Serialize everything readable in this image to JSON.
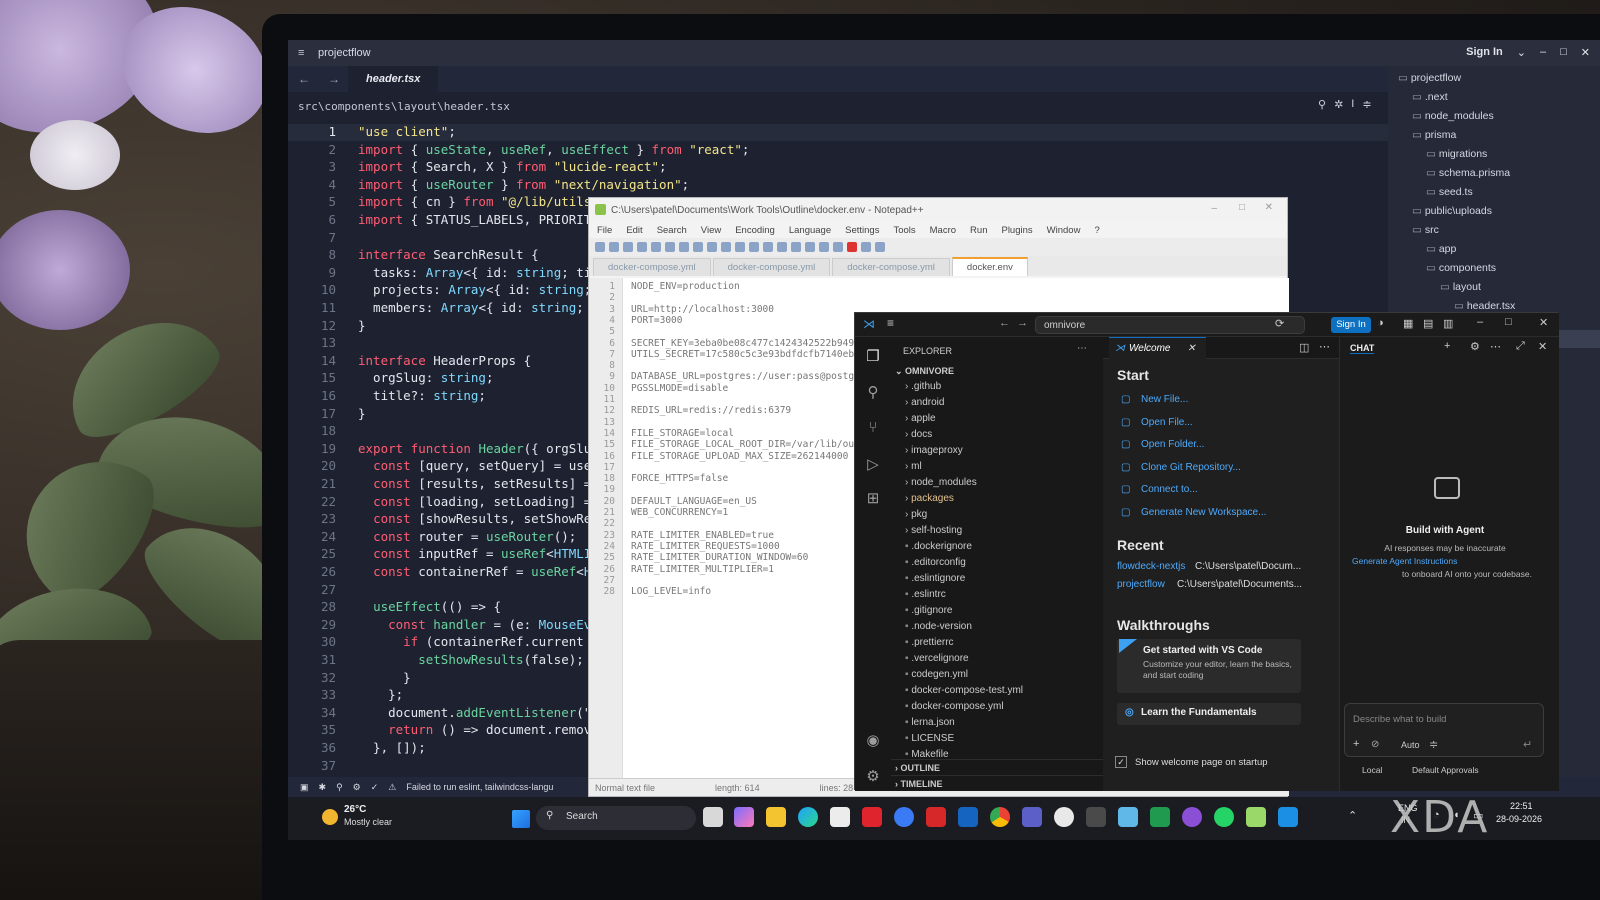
{
  "editor": {
    "app_title": "projectflow",
    "sign_in": "Sign In",
    "active_tab": "header.tsx",
    "breadcrumb": "src\\components\\layout\\header.tsx",
    "status_message": "Failed to run eslint, tailwindcss-langu",
    "code_lines": [
      {
        "n": "1",
        "t": "\"use client\";"
      },
      {
        "n": "2",
        "t": "import { useState, useRef, useEffect } from \"react\";"
      },
      {
        "n": "3",
        "t": "import { Search, X } from \"lucide-react\";"
      },
      {
        "n": "4",
        "t": "import { useRouter } from \"next/navigation\";"
      },
      {
        "n": "5",
        "t": "import { cn } from \"@/lib/utils\""
      },
      {
        "n": "6",
        "t": "import { STATUS_LABELS, PRIORITY"
      },
      {
        "n": "7",
        "t": ""
      },
      {
        "n": "8",
        "t": "interface SearchResult {"
      },
      {
        "n": "9",
        "t": "  tasks: Array<{ id: string; tit"
      },
      {
        "n": "10",
        "t": "  projects: Array<{ id: string;"
      },
      {
        "n": "11",
        "t": "  members: Array<{ id: string; n"
      },
      {
        "n": "12",
        "t": "}"
      },
      {
        "n": "13",
        "t": ""
      },
      {
        "n": "14",
        "t": "interface HeaderProps {"
      },
      {
        "n": "15",
        "t": "  orgSlug: string;"
      },
      {
        "n": "16",
        "t": "  title?: string;"
      },
      {
        "n": "17",
        "t": "}"
      },
      {
        "n": "18",
        "t": ""
      },
      {
        "n": "19",
        "t": "export function Header({ orgSlug"
      },
      {
        "n": "20",
        "t": "  const [query, setQuery] = useS"
      },
      {
        "n": "21",
        "t": "  const [results, setResults] ="
      },
      {
        "n": "22",
        "t": "  const [loading, setLoading] ="
      },
      {
        "n": "23",
        "t": "  const [showResults, setShowRes"
      },
      {
        "n": "24",
        "t": "  const router = useRouter();"
      },
      {
        "n": "25",
        "t": "  const inputRef = useRef<HTMLIn"
      },
      {
        "n": "26",
        "t": "  const containerRef = useRef<HT"
      },
      {
        "n": "27",
        "t": ""
      },
      {
        "n": "28",
        "t": "  useEffect(() => {"
      },
      {
        "n": "29",
        "t": "    const handler = (e: MouseEve"
      },
      {
        "n": "30",
        "t": "      if (containerRef.current &"
      },
      {
        "n": "31",
        "t": "        setShowResults(false);"
      },
      {
        "n": "32",
        "t": "      }"
      },
      {
        "n": "33",
        "t": "    };"
      },
      {
        "n": "34",
        "t": "    document.addEventListener(\"m"
      },
      {
        "n": "35",
        "t": "    return () => document.remove"
      },
      {
        "n": "36",
        "t": "  }, []);"
      },
      {
        "n": "37",
        "t": ""
      }
    ],
    "tree": [
      {
        "label": "projectflow",
        "indent": 0
      },
      {
        "label": ".next",
        "indent": 1
      },
      {
        "label": "node_modules",
        "indent": 1
      },
      {
        "label": "prisma",
        "indent": 1
      },
      {
        "label": "migrations",
        "indent": 2
      },
      {
        "label": "schema.prisma",
        "indent": 2
      },
      {
        "label": "seed.ts",
        "indent": 2
      },
      {
        "label": "public\\uploads",
        "indent": 1
      },
      {
        "label": "src",
        "indent": 1
      },
      {
        "label": "app",
        "indent": 2
      },
      {
        "label": "components",
        "indent": 2
      },
      {
        "label": "layout",
        "indent": 3
      },
      {
        "label": "header.tsx",
        "indent": 4
      }
    ]
  },
  "notepad": {
    "title": "C:\\Users\\patel\\Documents\\Work Tools\\Outline\\docker.env - Notepad++",
    "menu": [
      "File",
      "Edit",
      "Search",
      "View",
      "Encoding",
      "Language",
      "Settings",
      "Tools",
      "Macro",
      "Run",
      "Plugins",
      "Window",
      "?"
    ],
    "tabs": [
      "docker-compose.yml",
      "docker-compose.yml",
      "docker-compose.yml",
      "docker.env"
    ],
    "lines": [
      {
        "n": "1",
        "t": "NODE_ENV=production"
      },
      {
        "n": "2",
        "t": ""
      },
      {
        "n": "3",
        "t": "URL=http://localhost:3000"
      },
      {
        "n": "4",
        "t": "PORT=3000"
      },
      {
        "n": "5",
        "t": ""
      },
      {
        "n": "6",
        "t": "SECRET_KEY=3eba0be08c477c1424342522b949"
      },
      {
        "n": "7",
        "t": "UTILS_SECRET=17c580c5c3e93bdfdcfb7140eb"
      },
      {
        "n": "8",
        "t": ""
      },
      {
        "n": "9",
        "t": "DATABASE_URL=postgres://user:pass@postgr"
      },
      {
        "n": "10",
        "t": "PGSSLMODE=disable"
      },
      {
        "n": "11",
        "t": ""
      },
      {
        "n": "12",
        "t": "REDIS_URL=redis://redis:6379"
      },
      {
        "n": "13",
        "t": ""
      },
      {
        "n": "14",
        "t": "FILE_STORAGE=local"
      },
      {
        "n": "15",
        "t": "FILE_STORAGE_LOCAL_ROOT_DIR=/var/lib/out"
      },
      {
        "n": "16",
        "t": "FILE_STORAGE_UPLOAD_MAX_SIZE=262144000"
      },
      {
        "n": "17",
        "t": ""
      },
      {
        "n": "18",
        "t": "FORCE_HTTPS=false"
      },
      {
        "n": "19",
        "t": ""
      },
      {
        "n": "20",
        "t": "DEFAULT_LANGUAGE=en_US"
      },
      {
        "n": "21",
        "t": "WEB_CONCURRENCY=1"
      },
      {
        "n": "22",
        "t": ""
      },
      {
        "n": "23",
        "t": "RATE_LIMITER_ENABLED=true"
      },
      {
        "n": "24",
        "t": "RATE_LIMITER_REQUESTS=1000"
      },
      {
        "n": "25",
        "t": "RATE_LIMITER_DURATION_WINDOW=60"
      },
      {
        "n": "26",
        "t": "RATE_LIMITER_MULTIPLIER=1"
      },
      {
        "n": "27",
        "t": ""
      },
      {
        "n": "28",
        "t": "LOG_LEVEL=info"
      }
    ],
    "status_type": "Normal text file",
    "status_length": "length: 614",
    "status_lines": "lines: 28"
  },
  "vscode": {
    "search": "omnivore",
    "sign_in": "Sign In",
    "explorer_title": "EXPLORER",
    "root": "OMNIVORE",
    "files": [
      ".github",
      "android",
      "apple",
      "docs",
      "imageproxy",
      "ml",
      "node_modules",
      "packages",
      "pkg",
      "self-hosting",
      ".dockerignore",
      ".editorconfig",
      ".eslintignore",
      ".eslintrc",
      ".gitignore",
      ".node-version",
      ".prettierrc",
      ".vercelignore",
      "codegen.yml",
      "docker-compose-test.yml",
      "docker-compose.yml",
      "lerna.json",
      "LICENSE",
      "Makefile"
    ],
    "outline": "OUTLINE",
    "timeline": "TIMELINE",
    "welcome_tab": "Welcome",
    "start_heading": "Start",
    "start_links": [
      "New File...",
      "Open File...",
      "Open Folder...",
      "Clone Git Repository...",
      "Connect to...",
      "Generate New Workspace..."
    ],
    "recent_heading": "Recent",
    "recent": [
      {
        "name": "flowdeck-nextjs",
        "path": "C:\\Users\\patel\\Docum..."
      },
      {
        "name": "projectflow",
        "path": "C:\\Users\\patel\\Documents..."
      }
    ],
    "walkthroughs_heading": "Walkthroughs",
    "walk_title": "Get started with VS Code",
    "walk_desc": "Customize your editor, learn the basics, and start coding",
    "learn": "Learn the Fundamentals",
    "show_welcome": "Show welcome page on startup",
    "chat_tab": "CHAT",
    "build_title": "Build with Agent",
    "build_desc1": "AI responses may be inaccurate",
    "build_link": "Generate Agent Instructions",
    "build_desc2": "to onboard AI onto your codebase.",
    "chat_placeholder": "Describe what to build",
    "chat_mode": "Auto",
    "chat_local": "Local",
    "chat_approvals": "Default Approvals"
  },
  "taskbar": {
    "temp": "26°C",
    "weather": "Mostly clear",
    "search": "Search",
    "lang1": "ENG",
    "lang2": "IN",
    "time": "22:51",
    "date": "28-09-2026"
  },
  "watermark": "XDA"
}
